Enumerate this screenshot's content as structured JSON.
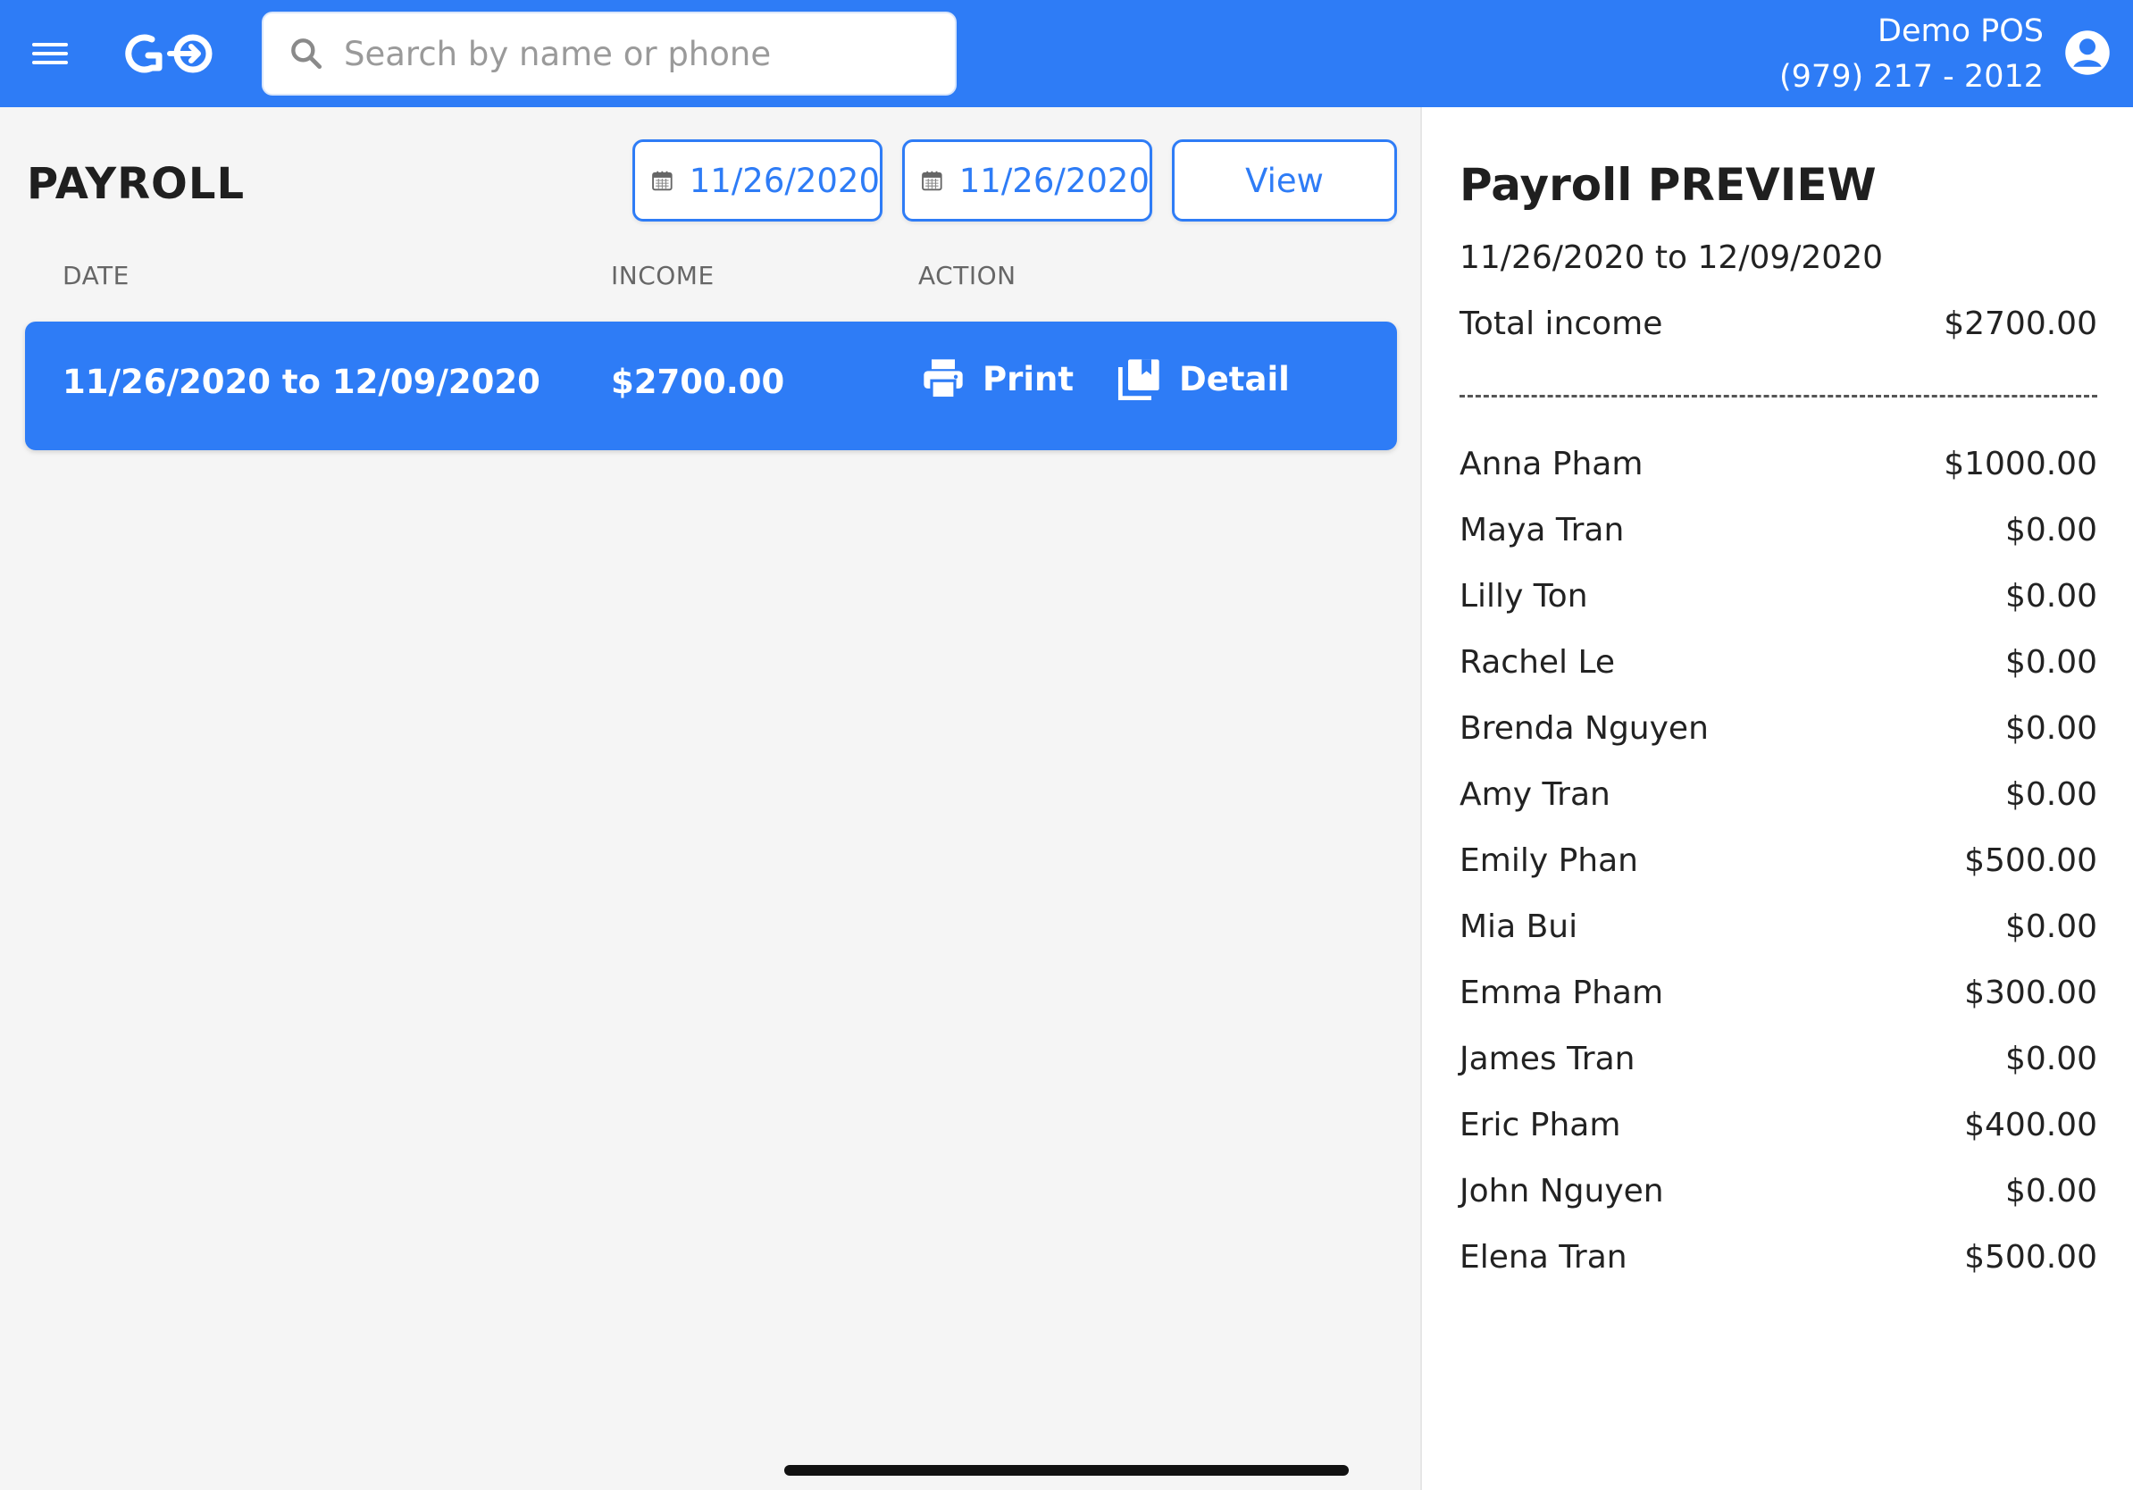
{
  "header": {
    "search_placeholder": "Search by name or phone",
    "account_name": "Demo POS",
    "account_phone": "(979) 217 - 2012",
    "brand_color": "#2e7cf6",
    "icons": [
      "menu-icon",
      "logo-icon",
      "search-icon",
      "account-icon"
    ]
  },
  "payroll": {
    "title": "PAYROLL",
    "start_date": "11/26/2020",
    "end_date": "11/26/2020",
    "view_label": "View",
    "columns": [
      "DATE",
      "INCOME",
      "ACTION"
    ],
    "rows": [
      {
        "date": "11/26/2020 to 12/09/2020",
        "income": "$2700.00",
        "print_label": "Print",
        "detail_label": "Detail"
      }
    ]
  },
  "preview": {
    "title": "Payroll PREVIEW",
    "range": "11/26/2020 to 12/09/2020",
    "total_label": "Total income",
    "total_value": "$2700.00",
    "employees": [
      {
        "name": "Anna Pham",
        "amount": "$1000.00"
      },
      {
        "name": "Maya Tran",
        "amount": "$0.00"
      },
      {
        "name": "Lilly Ton",
        "amount": "$0.00"
      },
      {
        "name": "Rachel Le",
        "amount": "$0.00"
      },
      {
        "name": "Brenda Nguyen",
        "amount": "$0.00"
      },
      {
        "name": "Amy Tran",
        "amount": "$0.00"
      },
      {
        "name": "Emily Phan",
        "amount": "$500.00"
      },
      {
        "name": "Mia Bui",
        "amount": "$0.00"
      },
      {
        "name": "Emma Pham",
        "amount": "$300.00"
      },
      {
        "name": "James Tran",
        "amount": "$0.00"
      },
      {
        "name": "Eric Pham",
        "amount": "$400.00"
      },
      {
        "name": "John Nguyen",
        "amount": "$0.00"
      },
      {
        "name": "Elena Tran",
        "amount": "$500.00"
      }
    ]
  }
}
